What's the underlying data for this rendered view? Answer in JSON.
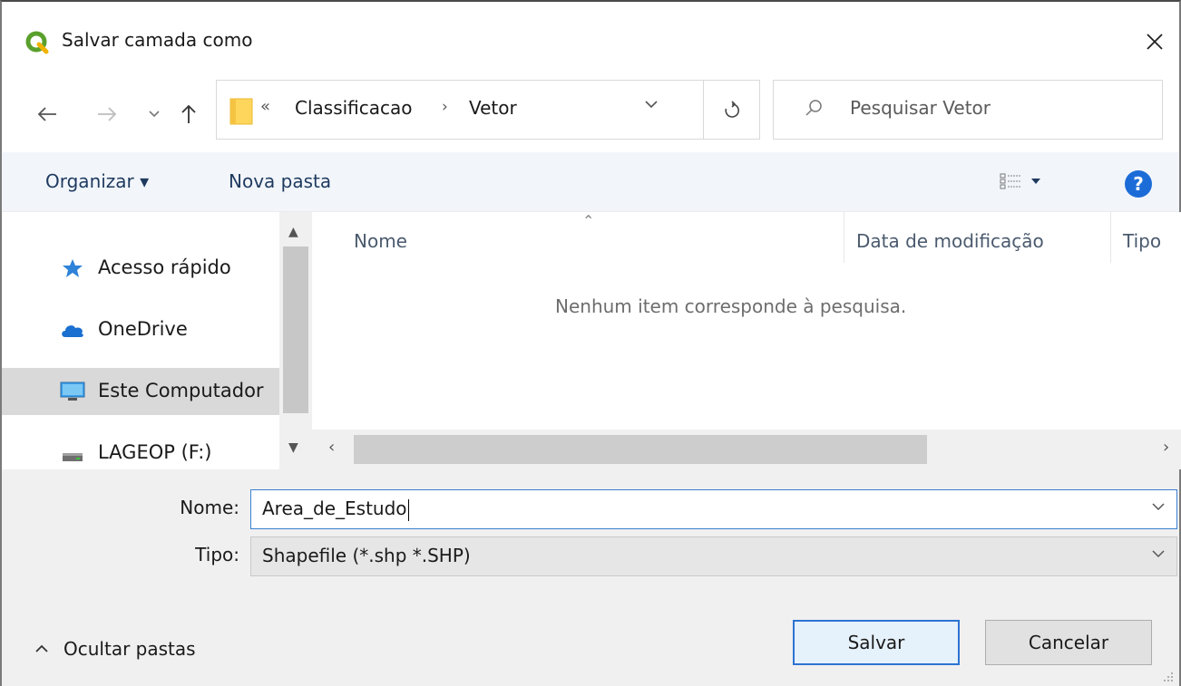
{
  "window": {
    "title": "Salvar camada como"
  },
  "address_bar": {
    "overflow": "«",
    "crumbs": [
      "Classificacao",
      "Vetor"
    ],
    "separator": "›"
  },
  "search": {
    "placeholder": "Pesquisar Vetor"
  },
  "toolbar": {
    "organize": "Organizar ▾",
    "new_folder": "Nova pasta"
  },
  "nav_pane": {
    "items": [
      {
        "label": "Acesso rápido",
        "icon": "star-pin-icon"
      },
      {
        "label": "OneDrive",
        "icon": "cloud-icon"
      },
      {
        "label": "Este Computador",
        "icon": "monitor-icon",
        "selected": true
      },
      {
        "label": "LAGEOP (F:)",
        "icon": "drive-icon"
      }
    ]
  },
  "file_list": {
    "columns": [
      "Nome",
      "Data de modificação",
      "Tipo"
    ],
    "empty_message": "Nenhum item corresponde à pesquisa."
  },
  "form": {
    "name_label": "Nome:",
    "name_value": "Area_de_Estudo",
    "type_label": "Tipo:",
    "type_value": "Shapefile (*.shp *.SHP)"
  },
  "footer": {
    "hide_folders": "Ocultar pastas"
  },
  "buttons": {
    "save": "Salvar",
    "cancel": "Cancelar"
  },
  "colors": {
    "accent": "#1c6cd8",
    "focus_border": "#3b7fd1",
    "qgis_green": "#5aa02c"
  }
}
